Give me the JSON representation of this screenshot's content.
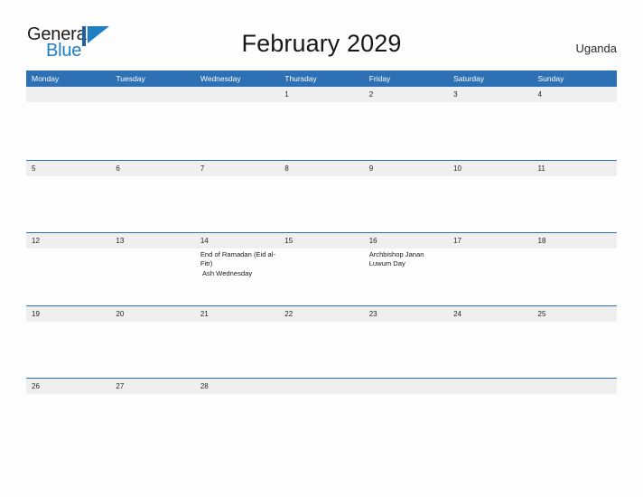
{
  "brand": {
    "name_part1": "General",
    "name_part2": "Blue",
    "mark_icon": "blue-flag-triangle-icon",
    "colors": {
      "dark": "#1c1c1c",
      "blue": "#1f7fc4"
    }
  },
  "header": {
    "title": "February 2029",
    "country": "Uganda"
  },
  "calendar": {
    "accent_color": "#2e70b4",
    "band_color": "#efefef",
    "weekdays": [
      "Monday",
      "Tuesday",
      "Wednesday",
      "Thursday",
      "Friday",
      "Saturday",
      "Sunday"
    ],
    "weeks": [
      {
        "days": [
          {
            "date": "",
            "events": []
          },
          {
            "date": "",
            "events": []
          },
          {
            "date": "",
            "events": []
          },
          {
            "date": "1",
            "events": []
          },
          {
            "date": "2",
            "events": []
          },
          {
            "date": "3",
            "events": []
          },
          {
            "date": "4",
            "events": []
          }
        ]
      },
      {
        "days": [
          {
            "date": "5",
            "events": []
          },
          {
            "date": "6",
            "events": []
          },
          {
            "date": "7",
            "events": []
          },
          {
            "date": "8",
            "events": []
          },
          {
            "date": "9",
            "events": []
          },
          {
            "date": "10",
            "events": []
          },
          {
            "date": "11",
            "events": []
          }
        ]
      },
      {
        "days": [
          {
            "date": "12",
            "events": []
          },
          {
            "date": "13",
            "events": []
          },
          {
            "date": "14",
            "events": [
              "End of Ramadan (Eid al-Fitr)",
              " Ash Wednesday"
            ]
          },
          {
            "date": "15",
            "events": []
          },
          {
            "date": "16",
            "events": [
              "Archbishop Janan Luwum Day"
            ]
          },
          {
            "date": "17",
            "events": []
          },
          {
            "date": "18",
            "events": []
          }
        ]
      },
      {
        "days": [
          {
            "date": "19",
            "events": []
          },
          {
            "date": "20",
            "events": []
          },
          {
            "date": "21",
            "events": []
          },
          {
            "date": "22",
            "events": []
          },
          {
            "date": "23",
            "events": []
          },
          {
            "date": "24",
            "events": []
          },
          {
            "date": "25",
            "events": []
          }
        ]
      },
      {
        "days": [
          {
            "date": "26",
            "events": []
          },
          {
            "date": "27",
            "events": []
          },
          {
            "date": "28",
            "events": []
          },
          {
            "date": "",
            "events": []
          },
          {
            "date": "",
            "events": []
          },
          {
            "date": "",
            "events": []
          },
          {
            "date": "",
            "events": []
          }
        ]
      }
    ]
  }
}
